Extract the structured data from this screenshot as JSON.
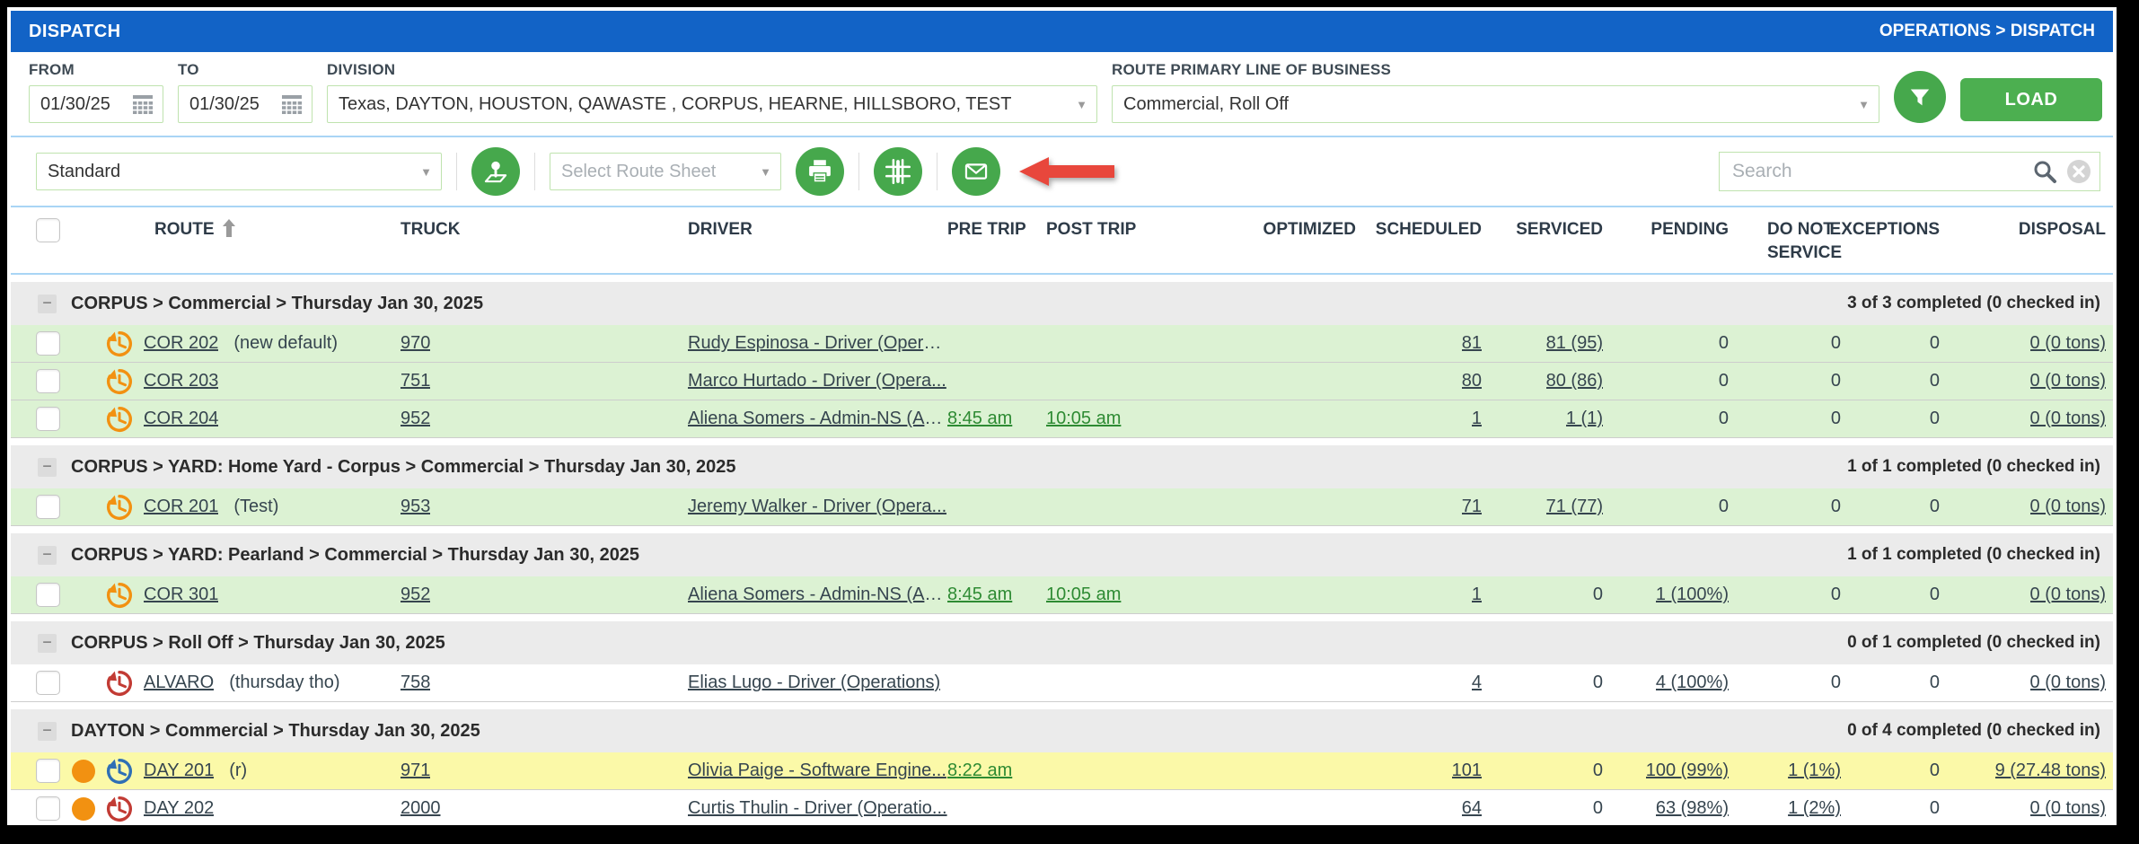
{
  "colors": {
    "header_blue": "#1263C6",
    "accent_green": "#46A84C",
    "load_green": "#4CAF50",
    "row_green": "#DCF2D3",
    "row_yellow": "#FBF9A8",
    "group_gray": "#EBEBEB",
    "time_green": "#2E8B33",
    "clock_orange": "#F29111",
    "clock_red": "#C23B34",
    "clock_blue": "#2F6FB5",
    "dot_orange": "#F29111",
    "arrow_red": "#E8473C",
    "input_border_green": "#BFE3AE"
  },
  "title_bar": {
    "title": "DISPATCH",
    "breadcrumb": "OPERATIONS > DISPATCH"
  },
  "filters": {
    "from_label": "FROM",
    "from_value": "01/30/25",
    "to_label": "TO",
    "to_value": "01/30/25",
    "division_label": "DIVISION",
    "division_value": "Texas, DAYTON, HOUSTON, QAWASTE , CORPUS, HEARNE, HILLSBORO, TEST",
    "lob_label": "ROUTE PRIMARY LINE OF BUSINESS",
    "lob_value": "Commercial, Roll Off",
    "load_button": "LOAD"
  },
  "toolbar": {
    "view_value": "Standard",
    "route_sheet_placeholder": "Select Route Sheet",
    "search_placeholder": "Search"
  },
  "table": {
    "columns": [
      "ROUTE",
      "TRUCK",
      "DRIVER",
      "PRE TRIP",
      "POST TRIP",
      "OPTIMIZED",
      "SCHEDULED",
      "SERVICED",
      "PENDING",
      "DO NOT SERVICE",
      "EXCEPTIONS",
      "DISPOSAL"
    ],
    "groups": [
      {
        "label": "CORPUS > Commercial > Thursday Jan 30, 2025",
        "summary": "3 of 3 completed (0 checked in)",
        "rows": [
          {
            "dot": false,
            "clock": "orange",
            "bg": "green",
            "route": "COR 202",
            "note": "(new default)",
            "truck": "970",
            "driver": "Rudy Espinosa - Driver (Operat...",
            "pre_trip": "",
            "post_trip": "",
            "optimized": "",
            "scheduled": "81",
            "serviced": "81 (95)",
            "pending": "0",
            "do_not_service": "0",
            "exceptions": "0",
            "disposal": "0 (0 tons)"
          },
          {
            "dot": false,
            "clock": "orange",
            "bg": "green",
            "route": "COR 203",
            "note": "",
            "truck": "751",
            "driver": "Marco Hurtado - Driver (Opera...",
            "pre_trip": "",
            "post_trip": "",
            "optimized": "",
            "scheduled": "80",
            "serviced": "80 (86)",
            "pending": "0",
            "do_not_service": "0",
            "exceptions": "0",
            "disposal": "0 (0 tons)"
          },
          {
            "dot": false,
            "clock": "orange",
            "bg": "green",
            "route": "COR 204",
            "note": "",
            "truck": "952",
            "driver": "Aliena Somers - Admin-NS (Admin)",
            "pre_trip": "8:45 am",
            "post_trip": "10:05 am",
            "optimized": "",
            "scheduled": "1",
            "serviced": "1 (1)",
            "pending": "0",
            "do_not_service": "0",
            "exceptions": "0",
            "disposal": "0 (0 tons)"
          }
        ]
      },
      {
        "label": "CORPUS > YARD: Home Yard - Corpus > Commercial > Thursday Jan 30, 2025",
        "summary": "1 of 1 completed (0 checked in)",
        "rows": [
          {
            "dot": false,
            "clock": "orange",
            "bg": "green",
            "route": "COR 201",
            "note": "(Test)",
            "truck": "953",
            "driver": "Jeremy Walker - Driver (Opera...",
            "pre_trip": "",
            "post_trip": "",
            "optimized": "",
            "scheduled": "71",
            "serviced": "71 (77)",
            "pending": "0",
            "do_not_service": "0",
            "exceptions": "0",
            "disposal": "0 (0 tons)"
          }
        ]
      },
      {
        "label": "CORPUS > YARD: Pearland > Commercial > Thursday Jan 30, 2025",
        "summary": "1 of 1 completed (0 checked in)",
        "rows": [
          {
            "dot": false,
            "clock": "orange",
            "bg": "green",
            "route": "COR 301",
            "note": "",
            "truck": "952",
            "driver": "Aliena Somers - Admin-NS (Admin)",
            "pre_trip": "8:45 am",
            "post_trip": "10:05 am",
            "optimized": "",
            "scheduled": "1",
            "serviced": "0",
            "pending": "1 (100%)",
            "do_not_service": "0",
            "exceptions": "0",
            "disposal": "0 (0 tons)"
          }
        ]
      },
      {
        "label": "CORPUS > Roll Off > Thursday Jan 30, 2025",
        "summary": "0 of 1 completed (0 checked in)",
        "rows": [
          {
            "dot": false,
            "clock": "red",
            "bg": "white",
            "route": "ALVARO",
            "note": "(thursday tho)",
            "truck": "758",
            "driver": "Elias Lugo - Driver (Operations)",
            "pre_trip": "",
            "post_trip": "",
            "optimized": "",
            "scheduled": "4",
            "serviced": "0",
            "pending": "4 (100%)",
            "do_not_service": "0",
            "exceptions": "0",
            "disposal": "0 (0 tons)"
          }
        ]
      },
      {
        "label": "DAYTON > Commercial > Thursday Jan 30, 2025",
        "summary": "0 of 4 completed (0 checked in)",
        "rows": [
          {
            "dot": true,
            "clock": "blue",
            "bg": "yellow",
            "route": "DAY 201",
            "note": "(r)",
            "truck": "971",
            "driver": "Olivia Paige - Software Engine...",
            "pre_trip": "8:22 am",
            "post_trip": "",
            "optimized": "",
            "scheduled": "101",
            "serviced": "0",
            "pending": "100 (99%)",
            "do_not_service": "1 (1%)",
            "exceptions": "0",
            "disposal": "9 (27.48 tons)"
          },
          {
            "dot": true,
            "clock": "red",
            "bg": "white",
            "route": "DAY 202",
            "note": "",
            "truck": "2000",
            "driver": "Curtis Thulin - Driver (Operatio...",
            "pre_trip": "",
            "post_trip": "",
            "optimized": "",
            "scheduled": "64",
            "serviced": "0",
            "pending": "63 (98%)",
            "do_not_service": "1 (2%)",
            "exceptions": "0",
            "disposal": "0 (0 tons)"
          }
        ]
      }
    ]
  }
}
